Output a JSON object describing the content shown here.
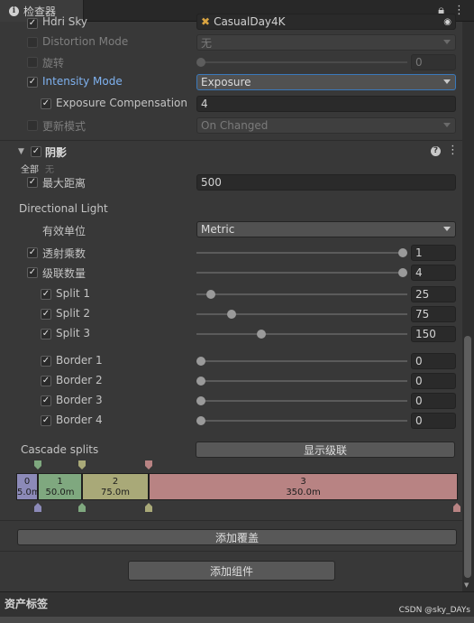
{
  "window": {
    "tab_title": "检查器",
    "lock_icon": "lock-icon",
    "menu_icon": "more-vertical-icon"
  },
  "sky": {
    "hdri_sky_label": "Hdri Sky",
    "hdri_sky_value": "CasualDay4K",
    "distortion_mode_label": "Distortion Mode",
    "distortion_mode_value": "无",
    "rotation_label": "旋转",
    "rotation_value": "0",
    "intensity_mode_label": "Intensity Mode",
    "intensity_mode_value": "Exposure",
    "exposure_comp_label": "Exposure Compensation",
    "exposure_comp_value": "4",
    "update_mode_label": "更新模式",
    "update_mode_value": "On Changed"
  },
  "shadows": {
    "header": "阴影",
    "all_label": "全部",
    "none_label": "无",
    "max_distance_label": "最大距离",
    "max_distance_value": "500",
    "directional_light_label": "Directional Light",
    "working_unit_label": "有效单位",
    "working_unit_value": "Metric",
    "transmission_label": "透射乘数",
    "transmission_value": "1",
    "transmission_level": 1.0,
    "cascade_count_label": "级联数量",
    "cascade_count_value": "4",
    "cascade_count_level": 1.0,
    "splits": [
      {
        "label": "Split 1",
        "value": "25",
        "level": 0.05
      },
      {
        "label": "Split 2",
        "value": "75",
        "level": 0.15
      },
      {
        "label": "Split 3",
        "value": "150",
        "level": 0.3
      }
    ],
    "borders": [
      {
        "label": "Border 1",
        "value": "0"
      },
      {
        "label": "Border 2",
        "value": "0"
      },
      {
        "label": "Border 3",
        "value": "0"
      },
      {
        "label": "Border 4",
        "value": "0"
      }
    ],
    "cascade_splits_label": "Cascade splits",
    "show_cascades_button": "显示级联",
    "cascade_bar": [
      {
        "index": "0",
        "distance": "5.0m",
        "color": "#8c8ab8"
      },
      {
        "index": "1",
        "distance": "50.0m",
        "color": "#7fa87f"
      },
      {
        "index": "2",
        "distance": "75.0m",
        "color": "#a9a978"
      },
      {
        "index": "3",
        "distance": "350.0m",
        "color": "#b88383"
      }
    ]
  },
  "footer": {
    "add_override_button": "添加覆盖",
    "add_component_button": "添加组件",
    "asset_labels": "资产标签",
    "watermark": "CSDN @sky_DAYs"
  },
  "colors": {
    "accent_blue": "#7fb2f0",
    "focus_border": "#3a79bb"
  }
}
